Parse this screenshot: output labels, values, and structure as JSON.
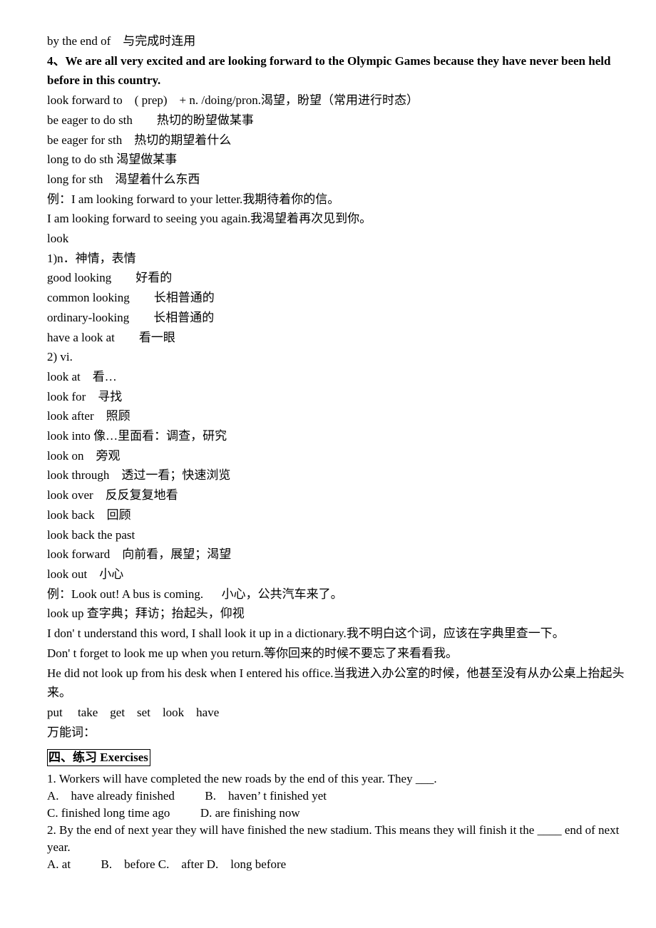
{
  "lines": [
    {
      "term": "by the end of",
      "sep": "    ",
      "meaning": "与完成时连用"
    },
    {
      "bold": "4、We are all very excited and are looking forward to the Olympic Games because they have never been held before in this country."
    },
    {
      "term": "look forward to",
      "sep": "    ",
      "meaning": "( prep)    + n. /doing/pron.渴望，盼望（常用进行时态）"
    },
    {
      "term": "be eager to do sth",
      "sep": "        ",
      "meaning": "热切的盼望做某事"
    },
    {
      "term": "be eager for sth",
      "sep": "    ",
      "meaning": "热切的期望着什么"
    },
    {
      "term": "long to do sth",
      "sep": " ",
      "meaning": "渴望做某事"
    },
    {
      "term": "long for sth",
      "sep": "    ",
      "meaning": "渴望着什么东西"
    },
    {
      "term": "例：I am looking forward to your letter.",
      "sep": "",
      "meaning": "我期待着你的信。"
    },
    {
      "term": "I am looking forward to seeing you again.",
      "sep": "",
      "meaning": "我渴望着再次见到你。"
    },
    {
      "term": "look",
      "sep": "",
      "meaning": ""
    },
    {
      "term": "1)n．神情，表情",
      "sep": "",
      "meaning": ""
    },
    {
      "term": "good looking",
      "sep": "        ",
      "meaning": "好看的"
    },
    {
      "term": "common looking",
      "sep": "        ",
      "meaning": "长相普通的"
    },
    {
      "term": "ordinary-looking",
      "sep": "        ",
      "meaning": "长相普通的"
    },
    {
      "term": "have a look at",
      "sep": "        ",
      "meaning": "看一眼"
    },
    {
      "term": "2) vi.",
      "sep": "",
      "meaning": ""
    },
    {
      "term": "look at",
      "sep": "    ",
      "meaning": "看…"
    },
    {
      "term": "look for",
      "sep": "    ",
      "meaning": "寻找"
    },
    {
      "term": "look after",
      "sep": "    ",
      "meaning": "照顾"
    },
    {
      "term": "look into",
      "sep": " ",
      "meaning": "像…里面看：调查，研究"
    },
    {
      "term": "look on",
      "sep": "    ",
      "meaning": "旁观"
    },
    {
      "term": "look through",
      "sep": "    ",
      "meaning": "透过一看；快速浏览"
    },
    {
      "term": "look over",
      "sep": "    ",
      "meaning": "反反复复地看"
    },
    {
      "term": "look back",
      "sep": "    ",
      "meaning": "回顾"
    },
    {
      "term": "look back the past",
      "sep": "",
      "meaning": ""
    },
    {
      "term": "look forward",
      "sep": "    ",
      "meaning": "向前看，展望；渴望"
    },
    {
      "term": "look out",
      "sep": "    ",
      "meaning": "小心"
    },
    {
      "term": "例：Look out! A bus is coming.",
      "sep": "      ",
      "meaning": "小心，公共汽车来了。"
    },
    {
      "term": "look up",
      "sep": " ",
      "meaning": "查字典；拜访；抬起头，仰视"
    },
    {
      "term": "I don' t understand this word, I shall look it up in a dictionary.",
      "sep": "",
      "meaning": "我不明白这个词，应该在字典里查一下。"
    },
    {
      "term": "Don' t forget to look me up when you return.",
      "sep": "",
      "meaning": "等你回来的时候不要忘了来看看我。"
    },
    {
      "wrap": "He did not look up from his desk when I entered his office.当我进入办公室的时候，他甚至没有从办公桌上抬起头来。"
    },
    {
      "term": "put     take    get    set    look    have",
      "sep": "",
      "meaning": ""
    },
    {
      "term": "万能词：",
      "sep": "",
      "meaning": ""
    }
  ],
  "section_heading": "四、练习 Exercises",
  "exercises": [
    {
      "question": "1. Workers will have completed the new roads by the end of this year. They ___.",
      "options_lines": [
        "A.    have already finished          B.    haven’ t finished yet",
        "C. finished long time ago          D. are finishing now"
      ]
    },
    {
      "question": "2. By the end of next year they will have finished the new stadium. This means they will finish it the ____ end of next year.",
      "options_lines": [
        "A. at          B.    before C.    after D.    long before"
      ]
    }
  ]
}
